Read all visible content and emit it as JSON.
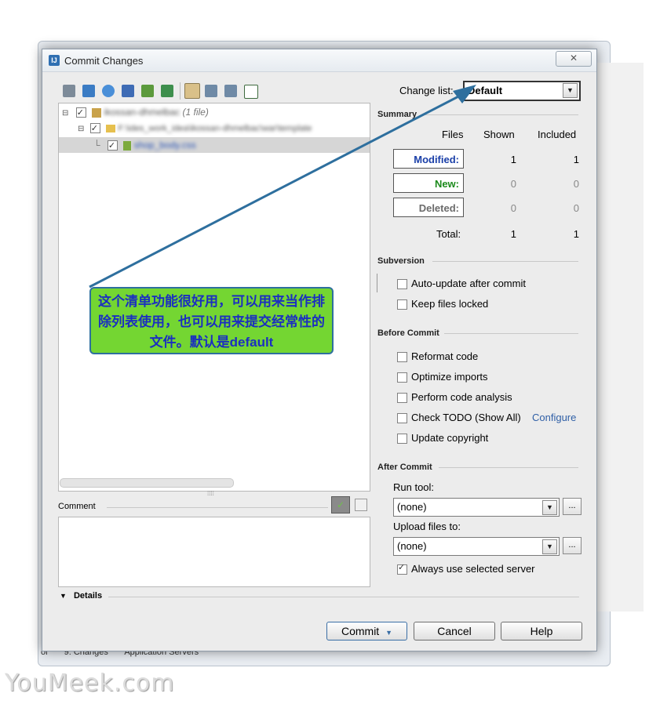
{
  "window": {
    "title": "Commit Changes",
    "close_label": "✕"
  },
  "background": {
    "bottom_items": [
      "ol",
      "9: Changes",
      "Application Servers"
    ]
  },
  "toolbar": {
    "icons": [
      "diff-icon",
      "refresh-icon",
      "sync-icon",
      "revert-icon",
      "edit-icon",
      "move-icon",
      "group-icon",
      "expand-all-icon",
      "collapse-all-icon",
      "select-all-icon"
    ]
  },
  "change_list": {
    "label": "Change list:",
    "value": "Default"
  },
  "tree": {
    "root": {
      "name": "ikossan-dhmelbac",
      "count": "(1 file)"
    },
    "folder": {
      "path": "F:\\ides_work_idea\\ikossan-dhmelbac\\war\\template"
    },
    "file": {
      "name": "shop_body.css"
    }
  },
  "summary": {
    "title": "Summary",
    "col_files": "Files",
    "col_shown": "Shown",
    "col_included": "Included",
    "rows": [
      {
        "label": "Modified:",
        "shown": "1",
        "included": "1"
      },
      {
        "label": "New:",
        "shown": "0",
        "included": "0"
      },
      {
        "label": "Deleted:",
        "shown": "0",
        "included": "0"
      }
    ],
    "total": {
      "label": "Total:",
      "shown": "1",
      "included": "1"
    }
  },
  "subversion": {
    "title": "Subversion",
    "options": [
      {
        "label": "Auto-update after commit",
        "checked": false
      },
      {
        "label": "Keep files locked",
        "checked": false
      }
    ]
  },
  "before_commit": {
    "title": "Before Commit",
    "options": [
      {
        "label": "Reformat code",
        "checked": false
      },
      {
        "label": "Optimize imports",
        "checked": false
      },
      {
        "label": "Perform code analysis",
        "checked": false
      },
      {
        "label": "Check TODO (Show All)",
        "checked": false
      },
      {
        "label": "Update copyright",
        "checked": false
      }
    ],
    "configure_label": "Configure"
  },
  "after_commit": {
    "title": "After Commit",
    "run_tool_label": "Run tool:",
    "run_tool_value": "(none)",
    "upload_label": "Upload files to:",
    "upload_value": "(none)",
    "always_label": "Always use selected server",
    "always_checked": true,
    "browse_label": "..."
  },
  "comment": {
    "label": "Comment",
    "value": ""
  },
  "details": {
    "label": "Details"
  },
  "buttons": {
    "commit": "Commit",
    "cancel": "Cancel",
    "help": "Help"
  },
  "annotation": {
    "text": "这个清单功能很好用，可以用来当作排除列表使用，也可以用来提交经常性的文件。默认是default"
  },
  "watermark": {
    "text": "YouMeek.com"
  },
  "colors": {
    "modified": "#1a3fa8",
    "new": "#1b8a1b",
    "deleted": "#6b6b6b",
    "link": "#2f5fa6",
    "note_bg": "#74d632",
    "note_text": "#1b2fc0",
    "arrow": "#2e6f9e"
  }
}
